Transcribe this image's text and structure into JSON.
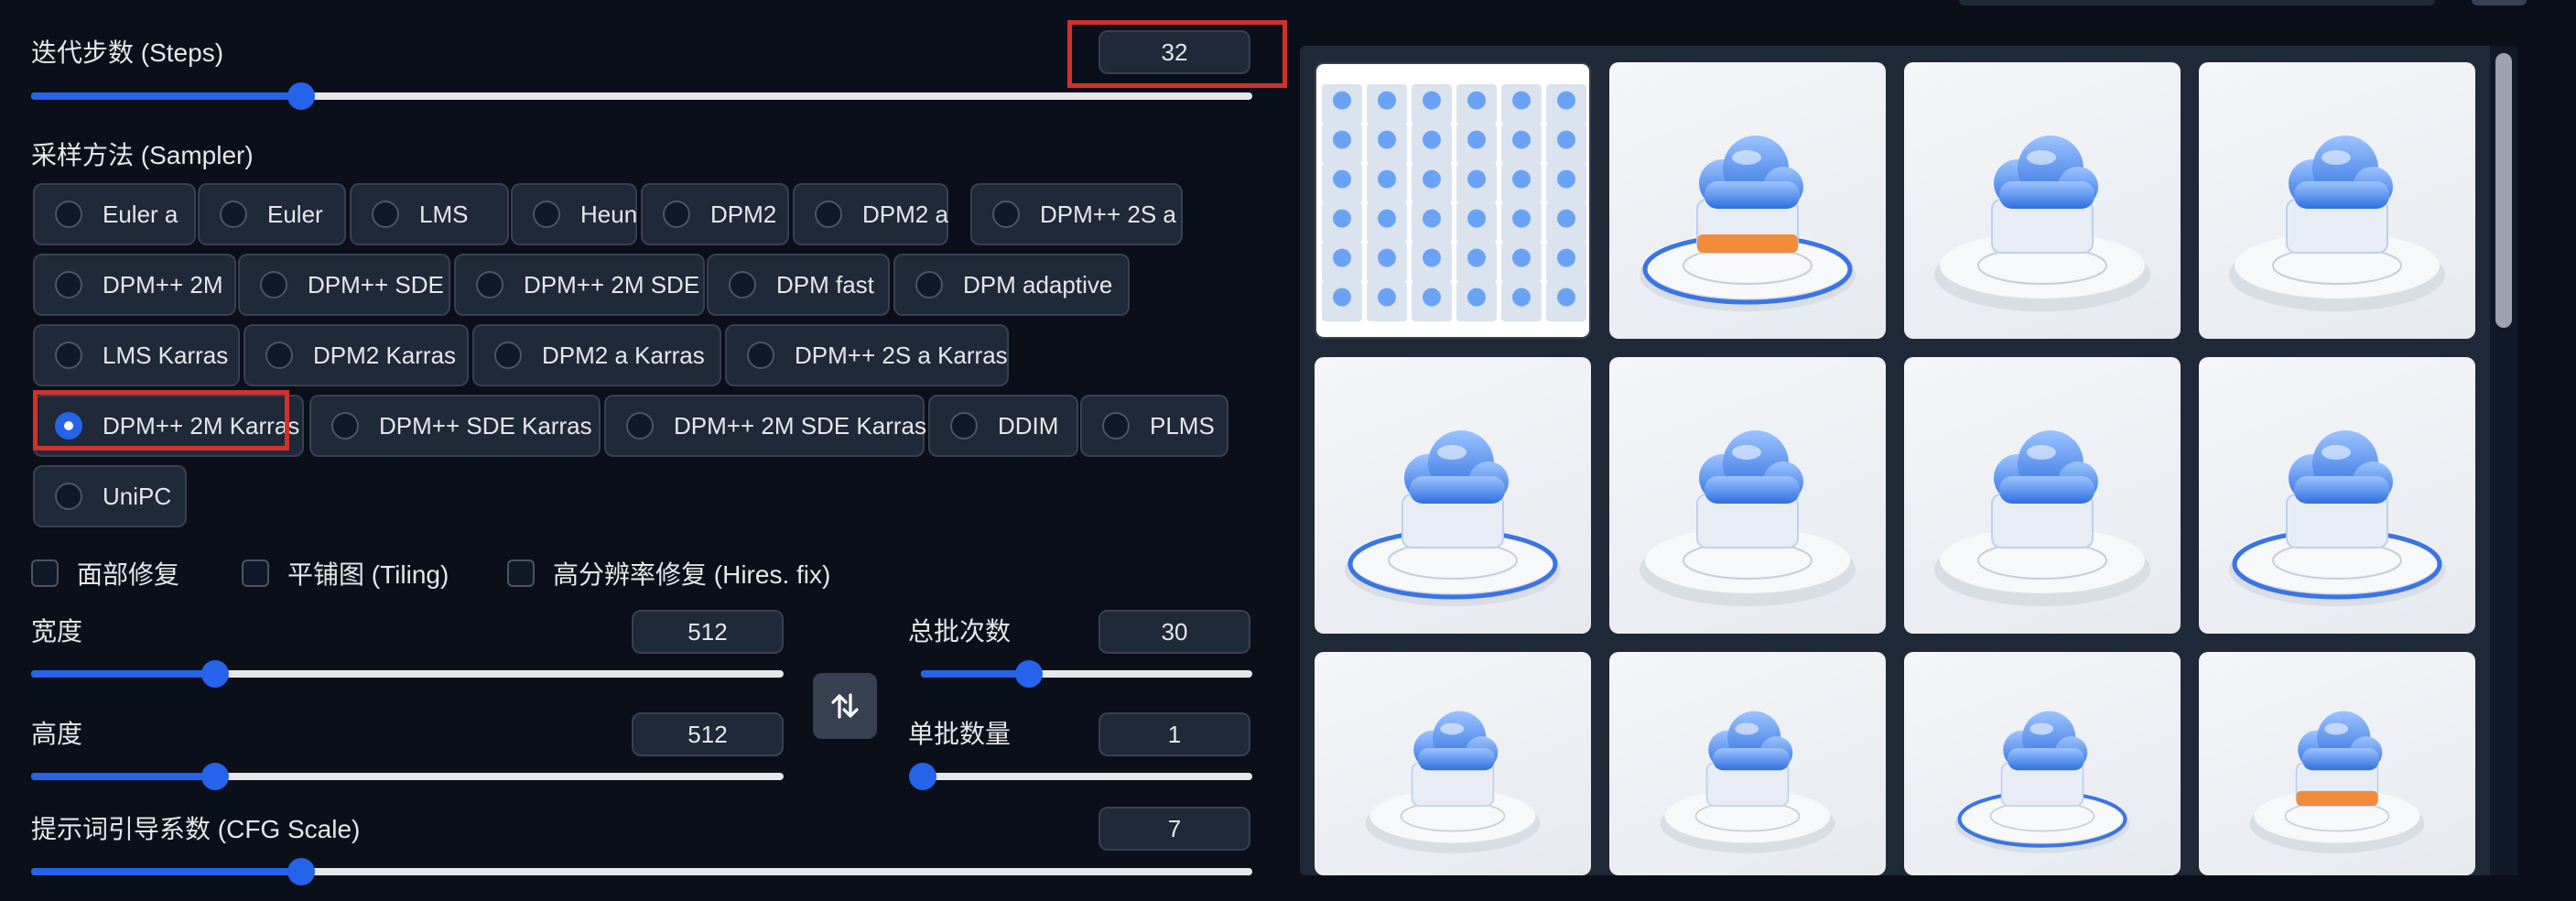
{
  "steps": {
    "label": "迭代步数 (Steps)",
    "value": "32",
    "fraction": 0.215
  },
  "sampler": {
    "label": "采样方法 (Sampler)",
    "options": [
      "Euler a",
      "Euler",
      "LMS",
      "Heun",
      "DPM2",
      "DPM2 a",
      "DPM++ 2S a",
      "DPM++ 2M",
      "DPM++ SDE",
      "DPM++ 2M SDE",
      "DPM fast",
      "DPM adaptive",
      "LMS Karras",
      "DPM2 Karras",
      "DPM2 a Karras",
      "DPM++ 2S a Karras",
      "DPM++ 2M Karras",
      "DPM++ SDE Karras",
      "DPM++ 2M SDE Karras",
      "DDIM",
      "PLMS",
      "UniPC"
    ],
    "selected": "DPM++ 2M Karras"
  },
  "checkboxes": {
    "face_restore": "面部修复",
    "tiling": "平铺图 (Tiling)",
    "hires_fix": "高分辨率修复 (Hires. fix)"
  },
  "width": {
    "label": "宽度",
    "value": "512",
    "fraction": 0.235
  },
  "height": {
    "label": "高度",
    "value": "512",
    "fraction": 0.235
  },
  "batch_count": {
    "label": "总批次数",
    "value": "30",
    "fraction": 0.31
  },
  "batch_size": {
    "label": "单批数量",
    "value": "1",
    "fraction": 0.0
  },
  "cfg_scale": {
    "label": "提示词引导系数 (CFG Scale)",
    "value": "7",
    "fraction": 0.215
  },
  "swap_icon": "swap-vertical-icon",
  "gallery": {
    "images": [
      "grid-preview",
      "cloud-orange",
      "server-cloud",
      "server-stack",
      "pix-box",
      "cloud-platform",
      "cube-cloud",
      "cloud-ring",
      "cloud-glass-warm",
      "cloud-dome",
      "cloud-pedestal",
      "cloud-orange-accent"
    ]
  },
  "colors": {
    "background": "#0b0f19",
    "accent": "#2563eb",
    "panel": "#1f2937",
    "highlight": "#d0312d"
  }
}
